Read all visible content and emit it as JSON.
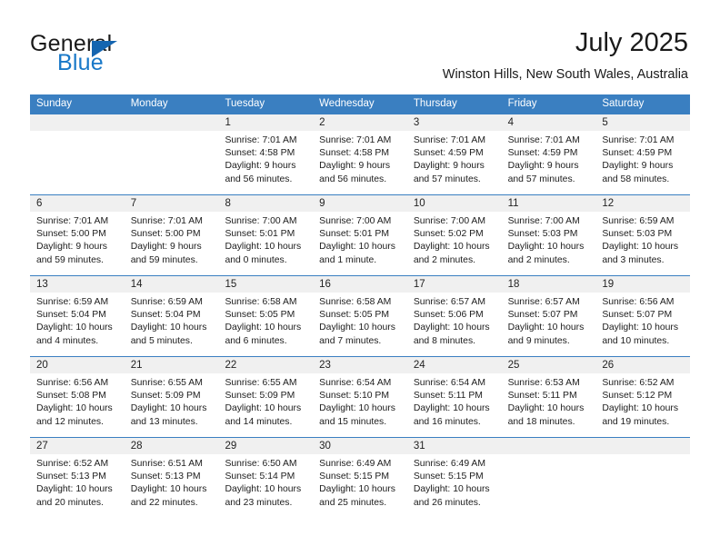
{
  "brand": {
    "name_part1": "General",
    "name_part2": "Blue",
    "accent_color": "#1878c8",
    "triangle_color": "#1565b0"
  },
  "header": {
    "title": "July 2025",
    "subtitle": "Winston Hills, New South Wales, Australia"
  },
  "theme": {
    "header_bg": "#3a7fc1",
    "header_text": "#ffffff",
    "daynum_bg": "#f0f0f0",
    "separator": "#3a7fc1"
  },
  "weekdays": [
    "Sunday",
    "Monday",
    "Tuesday",
    "Wednesday",
    "Thursday",
    "Friday",
    "Saturday"
  ],
  "weeks": [
    {
      "days": [
        {
          "num": "",
          "sunrise": "",
          "sunset": "",
          "daylight_line1": "",
          "daylight_line2": ""
        },
        {
          "num": "",
          "sunrise": "",
          "sunset": "",
          "daylight_line1": "",
          "daylight_line2": ""
        },
        {
          "num": "1",
          "sunrise": "Sunrise: 7:01 AM",
          "sunset": "Sunset: 4:58 PM",
          "daylight_line1": "Daylight: 9 hours",
          "daylight_line2": "and 56 minutes."
        },
        {
          "num": "2",
          "sunrise": "Sunrise: 7:01 AM",
          "sunset": "Sunset: 4:58 PM",
          "daylight_line1": "Daylight: 9 hours",
          "daylight_line2": "and 56 minutes."
        },
        {
          "num": "3",
          "sunrise": "Sunrise: 7:01 AM",
          "sunset": "Sunset: 4:59 PM",
          "daylight_line1": "Daylight: 9 hours",
          "daylight_line2": "and 57 minutes."
        },
        {
          "num": "4",
          "sunrise": "Sunrise: 7:01 AM",
          "sunset": "Sunset: 4:59 PM",
          "daylight_line1": "Daylight: 9 hours",
          "daylight_line2": "and 57 minutes."
        },
        {
          "num": "5",
          "sunrise": "Sunrise: 7:01 AM",
          "sunset": "Sunset: 4:59 PM",
          "daylight_line1": "Daylight: 9 hours",
          "daylight_line2": "and 58 minutes."
        }
      ]
    },
    {
      "days": [
        {
          "num": "6",
          "sunrise": "Sunrise: 7:01 AM",
          "sunset": "Sunset: 5:00 PM",
          "daylight_line1": "Daylight: 9 hours",
          "daylight_line2": "and 59 minutes."
        },
        {
          "num": "7",
          "sunrise": "Sunrise: 7:01 AM",
          "sunset": "Sunset: 5:00 PM",
          "daylight_line1": "Daylight: 9 hours",
          "daylight_line2": "and 59 minutes."
        },
        {
          "num": "8",
          "sunrise": "Sunrise: 7:00 AM",
          "sunset": "Sunset: 5:01 PM",
          "daylight_line1": "Daylight: 10 hours",
          "daylight_line2": "and 0 minutes."
        },
        {
          "num": "9",
          "sunrise": "Sunrise: 7:00 AM",
          "sunset": "Sunset: 5:01 PM",
          "daylight_line1": "Daylight: 10 hours",
          "daylight_line2": "and 1 minute."
        },
        {
          "num": "10",
          "sunrise": "Sunrise: 7:00 AM",
          "sunset": "Sunset: 5:02 PM",
          "daylight_line1": "Daylight: 10 hours",
          "daylight_line2": "and 2 minutes."
        },
        {
          "num": "11",
          "sunrise": "Sunrise: 7:00 AM",
          "sunset": "Sunset: 5:03 PM",
          "daylight_line1": "Daylight: 10 hours",
          "daylight_line2": "and 2 minutes."
        },
        {
          "num": "12",
          "sunrise": "Sunrise: 6:59 AM",
          "sunset": "Sunset: 5:03 PM",
          "daylight_line1": "Daylight: 10 hours",
          "daylight_line2": "and 3 minutes."
        }
      ]
    },
    {
      "days": [
        {
          "num": "13",
          "sunrise": "Sunrise: 6:59 AM",
          "sunset": "Sunset: 5:04 PM",
          "daylight_line1": "Daylight: 10 hours",
          "daylight_line2": "and 4 minutes."
        },
        {
          "num": "14",
          "sunrise": "Sunrise: 6:59 AM",
          "sunset": "Sunset: 5:04 PM",
          "daylight_line1": "Daylight: 10 hours",
          "daylight_line2": "and 5 minutes."
        },
        {
          "num": "15",
          "sunrise": "Sunrise: 6:58 AM",
          "sunset": "Sunset: 5:05 PM",
          "daylight_line1": "Daylight: 10 hours",
          "daylight_line2": "and 6 minutes."
        },
        {
          "num": "16",
          "sunrise": "Sunrise: 6:58 AM",
          "sunset": "Sunset: 5:05 PM",
          "daylight_line1": "Daylight: 10 hours",
          "daylight_line2": "and 7 minutes."
        },
        {
          "num": "17",
          "sunrise": "Sunrise: 6:57 AM",
          "sunset": "Sunset: 5:06 PM",
          "daylight_line1": "Daylight: 10 hours",
          "daylight_line2": "and 8 minutes."
        },
        {
          "num": "18",
          "sunrise": "Sunrise: 6:57 AM",
          "sunset": "Sunset: 5:07 PM",
          "daylight_line1": "Daylight: 10 hours",
          "daylight_line2": "and 9 minutes."
        },
        {
          "num": "19",
          "sunrise": "Sunrise: 6:56 AM",
          "sunset": "Sunset: 5:07 PM",
          "daylight_line1": "Daylight: 10 hours",
          "daylight_line2": "and 10 minutes."
        }
      ]
    },
    {
      "days": [
        {
          "num": "20",
          "sunrise": "Sunrise: 6:56 AM",
          "sunset": "Sunset: 5:08 PM",
          "daylight_line1": "Daylight: 10 hours",
          "daylight_line2": "and 12 minutes."
        },
        {
          "num": "21",
          "sunrise": "Sunrise: 6:55 AM",
          "sunset": "Sunset: 5:09 PM",
          "daylight_line1": "Daylight: 10 hours",
          "daylight_line2": "and 13 minutes."
        },
        {
          "num": "22",
          "sunrise": "Sunrise: 6:55 AM",
          "sunset": "Sunset: 5:09 PM",
          "daylight_line1": "Daylight: 10 hours",
          "daylight_line2": "and 14 minutes."
        },
        {
          "num": "23",
          "sunrise": "Sunrise: 6:54 AM",
          "sunset": "Sunset: 5:10 PM",
          "daylight_line1": "Daylight: 10 hours",
          "daylight_line2": "and 15 minutes."
        },
        {
          "num": "24",
          "sunrise": "Sunrise: 6:54 AM",
          "sunset": "Sunset: 5:11 PM",
          "daylight_line1": "Daylight: 10 hours",
          "daylight_line2": "and 16 minutes."
        },
        {
          "num": "25",
          "sunrise": "Sunrise: 6:53 AM",
          "sunset": "Sunset: 5:11 PM",
          "daylight_line1": "Daylight: 10 hours",
          "daylight_line2": "and 18 minutes."
        },
        {
          "num": "26",
          "sunrise": "Sunrise: 6:52 AM",
          "sunset": "Sunset: 5:12 PM",
          "daylight_line1": "Daylight: 10 hours",
          "daylight_line2": "and 19 minutes."
        }
      ]
    },
    {
      "days": [
        {
          "num": "27",
          "sunrise": "Sunrise: 6:52 AM",
          "sunset": "Sunset: 5:13 PM",
          "daylight_line1": "Daylight: 10 hours",
          "daylight_line2": "and 20 minutes."
        },
        {
          "num": "28",
          "sunrise": "Sunrise: 6:51 AM",
          "sunset": "Sunset: 5:13 PM",
          "daylight_line1": "Daylight: 10 hours",
          "daylight_line2": "and 22 minutes."
        },
        {
          "num": "29",
          "sunrise": "Sunrise: 6:50 AM",
          "sunset": "Sunset: 5:14 PM",
          "daylight_line1": "Daylight: 10 hours",
          "daylight_line2": "and 23 minutes."
        },
        {
          "num": "30",
          "sunrise": "Sunrise: 6:49 AM",
          "sunset": "Sunset: 5:15 PM",
          "daylight_line1": "Daylight: 10 hours",
          "daylight_line2": "and 25 minutes."
        },
        {
          "num": "31",
          "sunrise": "Sunrise: 6:49 AM",
          "sunset": "Sunset: 5:15 PM",
          "daylight_line1": "Daylight: 10 hours",
          "daylight_line2": "and 26 minutes."
        },
        {
          "num": "",
          "sunrise": "",
          "sunset": "",
          "daylight_line1": "",
          "daylight_line2": ""
        },
        {
          "num": "",
          "sunrise": "",
          "sunset": "",
          "daylight_line1": "",
          "daylight_line2": ""
        }
      ]
    }
  ]
}
